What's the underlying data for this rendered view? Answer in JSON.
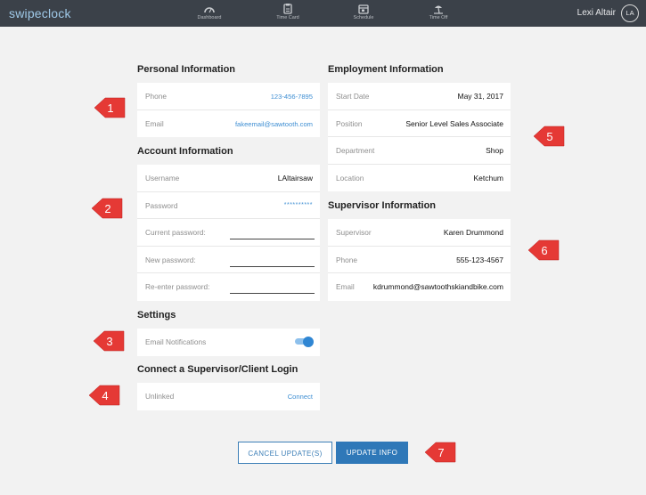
{
  "app": {
    "logo": "swipeclock"
  },
  "nav": [
    {
      "label": "Dashboard",
      "icon": "gauge-icon"
    },
    {
      "label": "Time Card",
      "icon": "time-card-icon"
    },
    {
      "label": "Schedule",
      "icon": "calendar-icon"
    },
    {
      "label": "Time Off",
      "icon": "beach-icon"
    }
  ],
  "user": {
    "name": "Lexi Altair",
    "initials": "LA"
  },
  "personal": {
    "title": "Personal Information",
    "phone_label": "Phone",
    "phone_value": "123-456-7895",
    "email_label": "Email",
    "email_value": "fakeemail@sawtooth.com"
  },
  "account": {
    "title": "Account Information",
    "username_label": "Username",
    "username_value": "LAltairsaw",
    "password_label": "Password",
    "password_value": "**********",
    "current_label": "Current password:",
    "new_label": "New password:",
    "reenter_label": "Re-enter password:"
  },
  "settings": {
    "title": "Settings",
    "email_notifications_label": "Email Notifications",
    "email_notifications_on": true
  },
  "connect": {
    "title": "Connect a Supervisor/Client Login",
    "status": "Unlinked",
    "action": "Connect"
  },
  "employment": {
    "title": "Employment Information",
    "start_label": "Start Date",
    "start_value": "May 31, 2017",
    "position_label": "Position",
    "position_value": "Senior Level Sales Associate",
    "department_label": "Department",
    "department_value": "Shop",
    "location_label": "Location",
    "location_value": "Ketchum"
  },
  "supervisor": {
    "title": "Supervisor Information",
    "name_label": "Supervisor",
    "name_value": "Karen Drummond",
    "phone_label": "Phone",
    "phone_value": "555-123-4567",
    "email_label": "Email",
    "email_value": "kdrummond@sawtoothskiandbike.com"
  },
  "buttons": {
    "cancel": "CANCEL UPDATE(S)",
    "update": "UPDATE INFO"
  },
  "callouts": [
    "1",
    "2",
    "3",
    "4",
    "5",
    "6",
    "7"
  ],
  "colors": {
    "topbar": "#3b4149",
    "accent": "#2f78b8",
    "link": "#3f8fd3",
    "callout": "#e53935"
  }
}
